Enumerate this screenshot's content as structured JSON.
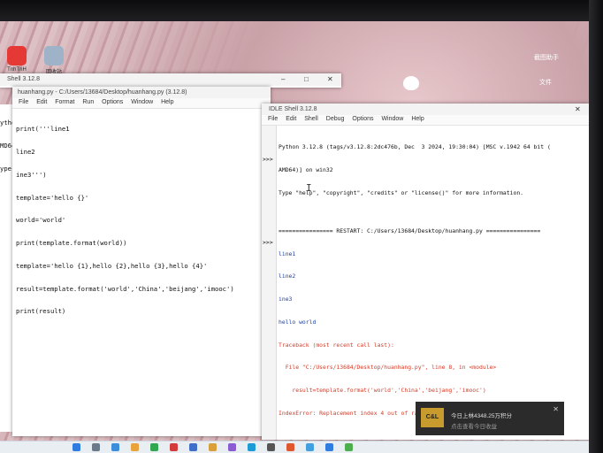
{
  "desktop": {
    "icons": [
      {
        "label": "TnhTnH"
      },
      {
        "label": "回收站"
      }
    ],
    "right_labels": [
      "截图助手",
      "文件"
    ]
  },
  "partial_window": {
    "title": "Shell 3.12.8",
    "gutter_text": [
      "ytho",
      "MD64",
      "ype"
    ]
  },
  "editor": {
    "title": "huanhang.py - C:/Users/13684/Desktop/huanhang.py (3.12.8)",
    "menu": [
      "File",
      "Edit",
      "Format",
      "Run",
      "Options",
      "Window",
      "Help"
    ],
    "lines": [
      "print('''line1",
      "line2",
      "ine3''')",
      "template='hello {}'",
      "world='world'",
      "print(template.format(world))",
      "template='hello {1},hello {2},hello {3},hello {4}'",
      "result=template.format('world','China','beijang','imooc')",
      "print(result)"
    ]
  },
  "shell": {
    "title": "IDLE Shell 3.12.8",
    "menu": [
      "File",
      "Edit",
      "Shell",
      "Debug",
      "Options",
      "Window",
      "Help"
    ],
    "prompt": ">>>",
    "lines": [
      {
        "text": "Python 3.12.8 (tags/v3.12.8:2dc476b, Dec  3 2024, 19:30:04) [MSC v.1942 64 bit (",
        "cls": "blk"
      },
      {
        "text": "AMD64)] on win32",
        "cls": "blk"
      },
      {
        "text": "Type \"help\", \"copyright\", \"credits\" or \"license()\" for more information.",
        "cls": "blk"
      },
      {
        "text": "",
        "cls": "blk"
      },
      {
        "text": "================ RESTART: C:/Users/13684/Desktop/huanhang.py ================",
        "cls": "blk"
      },
      {
        "text": "line1",
        "cls": "blue"
      },
      {
        "text": "line2",
        "cls": "blue"
      },
      {
        "text": "ine3",
        "cls": "blue"
      },
      {
        "text": "hello world",
        "cls": "blue"
      },
      {
        "text": "Traceback (most recent call last):",
        "cls": "red"
      },
      {
        "text": "  File \"C:/Users/13684/Desktop/huanhang.py\", line 8, in <module>",
        "cls": "red"
      },
      {
        "text": "    result=template.format('world','China','beijang','imooc')",
        "cls": "red"
      },
      {
        "text": "IndexError: Replacement index 4 out of range for positional args tuple",
        "cls": "red"
      }
    ]
  },
  "notification": {
    "logo": "C&L",
    "line1": "今日上林4348.25万积分",
    "line2": "点击查看今日收益"
  },
  "colors": {
    "code_blue": "#1a3fa8",
    "error_red": "#d63a26",
    "desktop_pink": "#cfb0b4"
  }
}
